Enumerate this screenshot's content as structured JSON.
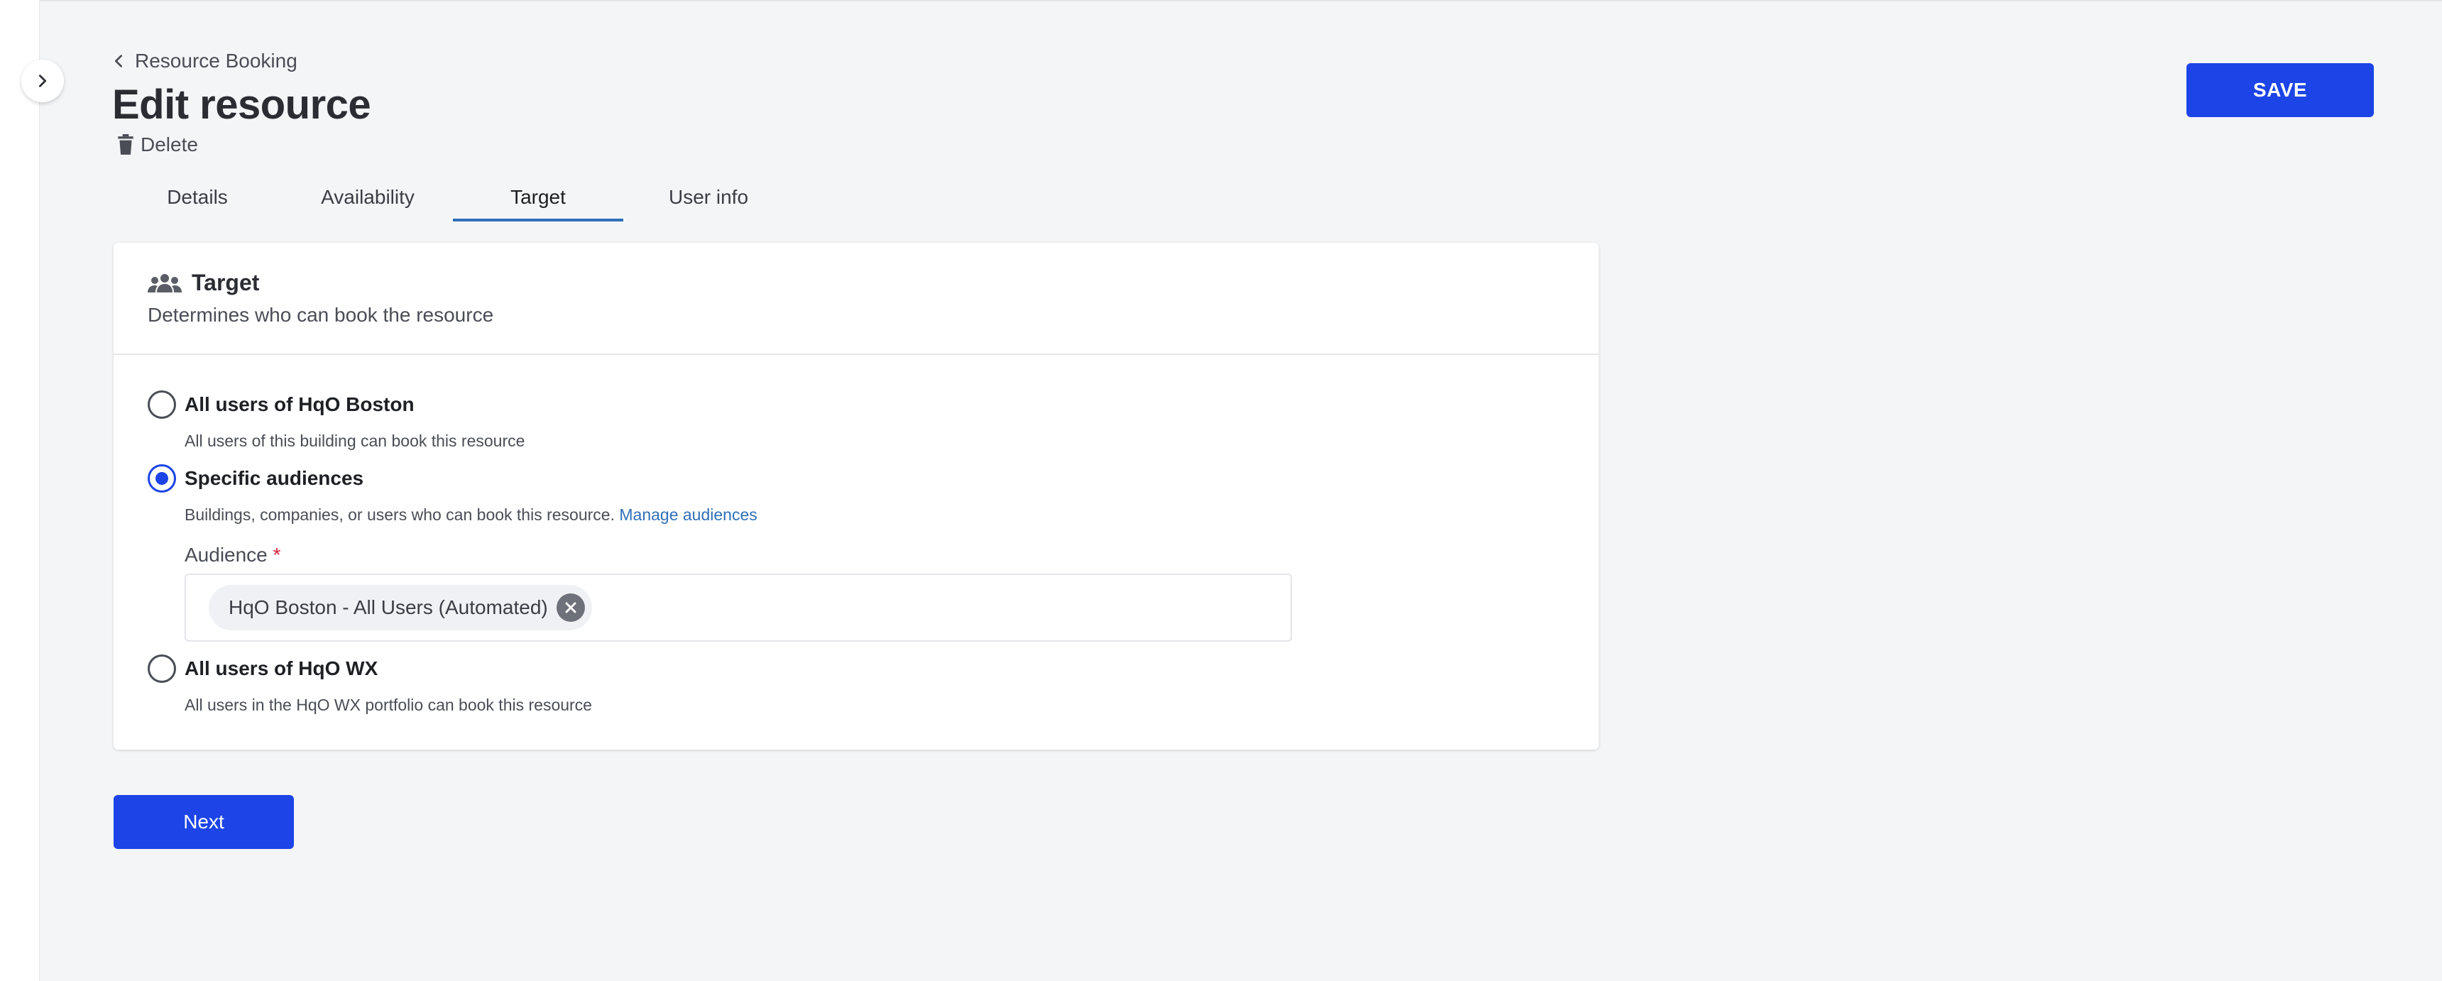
{
  "breadcrumb": {
    "label": "Resource Booking",
    "icon": "chevron-left-icon"
  },
  "page": {
    "title": "Edit resource",
    "delete_label": "Delete"
  },
  "toolbar": {
    "save_label": "SAVE"
  },
  "tabs": [
    {
      "label": "Details",
      "active": false
    },
    {
      "label": "Availability",
      "active": false
    },
    {
      "label": "Target",
      "active": true
    },
    {
      "label": "User info",
      "active": false
    }
  ],
  "card": {
    "title": "Target",
    "title_icon": "people-group-icon",
    "subtitle": "Determines who can book the resource",
    "options": [
      {
        "label": "All users of HqO Boston",
        "description": "All users of this building can book this resource",
        "selected": false
      },
      {
        "label": "Specific audiences",
        "description": "Buildings, companies, or users who can book this resource.",
        "link": "Manage audiences",
        "selected": true
      },
      {
        "label": "All users of HqO WX",
        "description": "All users in the HqO WX portfolio can book this resource",
        "selected": false
      }
    ],
    "audience": {
      "label": "Audience",
      "required_mark": "*",
      "chips": [
        "HqO Boston - All Users (Automated)"
      ]
    }
  },
  "footer": {
    "next_label": "Next"
  },
  "colors": {
    "primary": "#1c44e7",
    "link": "#2f6fb8",
    "required": "#d0233a",
    "background": "#f4f5f7"
  }
}
